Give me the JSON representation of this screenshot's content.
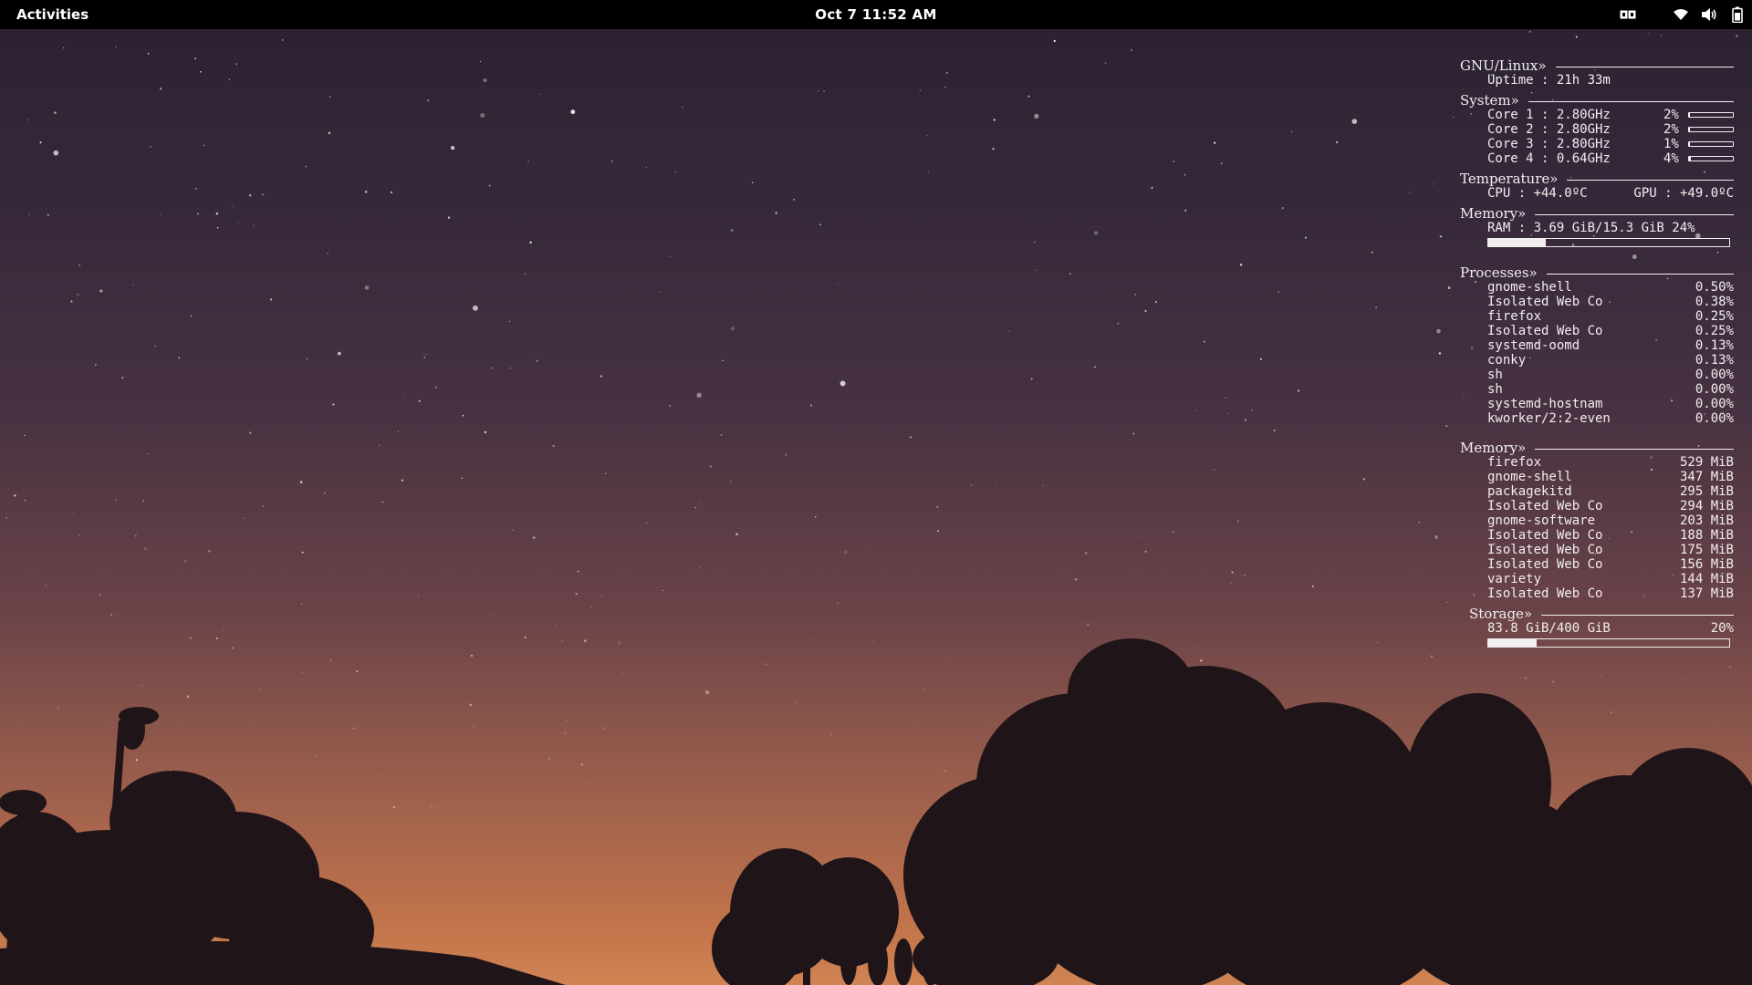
{
  "topbar": {
    "activities_label": "Activities",
    "clock": "Oct 7  11:52 AM",
    "icons": [
      "workspace-indicator-icon",
      "wifi-icon",
      "volume-icon",
      "battery-icon"
    ]
  },
  "conky": {
    "linux": {
      "header": "GNU/Linux»",
      "uptime_label": "Uptime : 21h 33m"
    },
    "system": {
      "header": "System»",
      "cores": [
        {
          "text": "Core 1 : 2.80GHz",
          "pct": "2%",
          "value": 0.02
        },
        {
          "text": "Core 2 : 2.80GHz",
          "pct": "2%",
          "value": 0.02
        },
        {
          "text": "Core 3 : 2.80GHz",
          "pct": "1%",
          "value": 0.01
        },
        {
          "text": "Core 4 : 0.64GHz",
          "pct": "4%",
          "value": 0.04
        }
      ]
    },
    "temperature": {
      "header": "Temperature»",
      "cpu": "CPU : +44.0ºC",
      "gpu": "GPU : +49.0ºC"
    },
    "memory": {
      "header": "Memory»",
      "ram": "RAM : 3.69 GiB/15.3 GiB 24%",
      "ram_fraction": 0.24
    },
    "processes": {
      "header": "Processes»",
      "rows": [
        {
          "name": "gnome-shell",
          "value": "0.50%"
        },
        {
          "name": "Isolated Web Co",
          "value": "0.38%"
        },
        {
          "name": "firefox",
          "value": "0.25%"
        },
        {
          "name": "Isolated Web Co",
          "value": "0.25%"
        },
        {
          "name": "systemd-oomd",
          "value": "0.13%"
        },
        {
          "name": "conky",
          "value": "0.13%"
        },
        {
          "name": "sh",
          "value": "0.00%"
        },
        {
          "name": "sh",
          "value": "0.00%"
        },
        {
          "name": "systemd-hostnam",
          "value": "0.00%"
        },
        {
          "name": "kworker/2:2-even",
          "value": "0.00%"
        }
      ]
    },
    "memory_top": {
      "header": "Memory»",
      "rows": [
        {
          "name": "firefox",
          "value": "529 MiB"
        },
        {
          "name": "gnome-shell",
          "value": "347 MiB"
        },
        {
          "name": "packagekitd",
          "value": "295 MiB"
        },
        {
          "name": "Isolated Web Co",
          "value": "294 MiB"
        },
        {
          "name": "gnome-software",
          "value": "203 MiB"
        },
        {
          "name": "Isolated Web Co",
          "value": "188 MiB"
        },
        {
          "name": "Isolated Web Co",
          "value": "175 MiB"
        },
        {
          "name": "Isolated Web Co",
          "value": "156 MiB"
        },
        {
          "name": "variety",
          "value": "144 MiB"
        },
        {
          "name": "Isolated Web Co",
          "value": "137 MiB"
        }
      ]
    },
    "storage": {
      "header": "Storage»",
      "usage": "83.8 GiB/400 GiB",
      "pct": "20%",
      "fraction": 0.2
    }
  }
}
